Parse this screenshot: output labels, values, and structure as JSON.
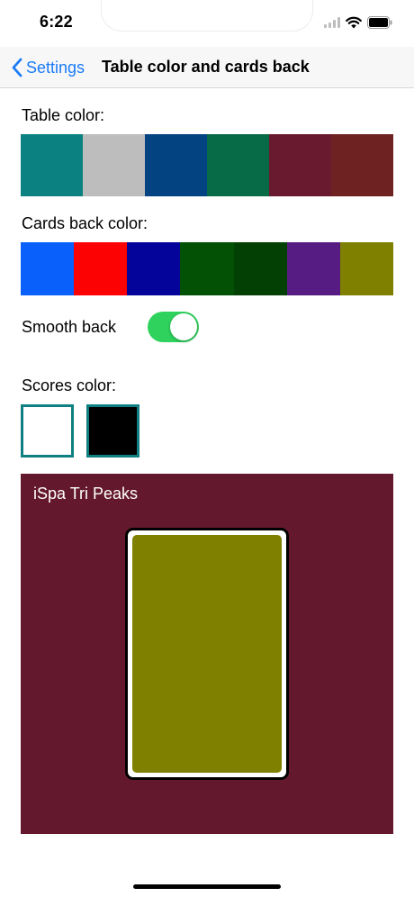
{
  "status_bar": {
    "time": "6:22"
  },
  "nav": {
    "back_label": "Settings",
    "title": "Table color and cards back"
  },
  "table_color": {
    "label": "Table color:",
    "swatches": [
      "#0c8182",
      "#bdbdbd",
      "#034381",
      "#076b47",
      "#6a1a2e",
      "#6e2222"
    ]
  },
  "cards_back_color": {
    "label": "Cards back color:",
    "swatches": [
      "#0a60fa",
      "#fc0202",
      "#04049a",
      "#035105",
      "#034003",
      "#561c83",
      "#808000"
    ]
  },
  "smooth_back": {
    "label": "Smooth back",
    "on": true
  },
  "scores_color": {
    "label": "Scores color:",
    "swatches": [
      "#ffffff",
      "#000000"
    ],
    "selected_border": "#0f7f82"
  },
  "preview": {
    "title": "iSpa Tri Peaks",
    "table_color": "#64182d",
    "card_back_color": "#808000"
  },
  "colors": {
    "accent": "#1a7cf5",
    "toggle_on": "#2fd25d"
  }
}
